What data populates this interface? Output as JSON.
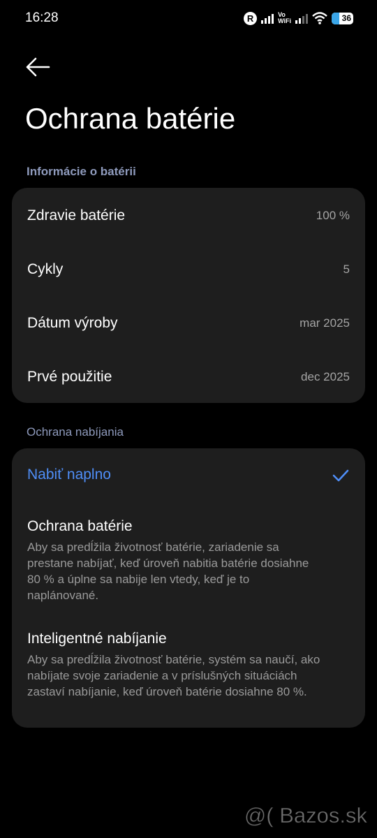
{
  "status_bar": {
    "time": "16:28",
    "r_badge": "R",
    "vowifi_top": "Vo",
    "vowifi_bottom": "WiFi",
    "battery_level": "36",
    "battery_fraction": 0.36,
    "icons": [
      "r-badge-icon",
      "signal-icon",
      "vowifi-icon",
      "signal-icon",
      "wifi-icon",
      "battery-icon"
    ]
  },
  "header": {
    "back_icon": "arrow-left-icon",
    "title": "Ochrana batérie"
  },
  "battery_info": {
    "section_title": "Informácie o batérii",
    "rows": [
      {
        "label": "Zdravie batérie",
        "value": "100 %"
      },
      {
        "label": "Cykly",
        "value": "5"
      },
      {
        "label": "Dátum výroby",
        "value": "mar 2025"
      },
      {
        "label": "Prvé použitie",
        "value": "dec 2025"
      }
    ]
  },
  "charging_protection": {
    "section_title": "Ochrana nabíjania",
    "accent_color": "#4f8ef7",
    "options": [
      {
        "title": "Nabiť naplno",
        "selected": true,
        "description": ""
      },
      {
        "title": "Ochrana batérie",
        "selected": false,
        "description": "Aby sa predĺžila životnosť batérie, zariadenie sa prestane nabíjať, keď úroveň nabitia batérie dosiahne 80 % a úplne sa nabije len vtedy, keď je to naplánované."
      },
      {
        "title": "Inteligentné nabíjanie",
        "selected": false,
        "description": "Aby sa predĺžila životnosť batérie, systém sa naučí, ako nabíjate svoje zariadenie a v príslušných situáciách zastaví nabíjanie, keď úroveň batérie dosiahne 80 %."
      }
    ]
  },
  "watermark": "@( Bazos.sk"
}
